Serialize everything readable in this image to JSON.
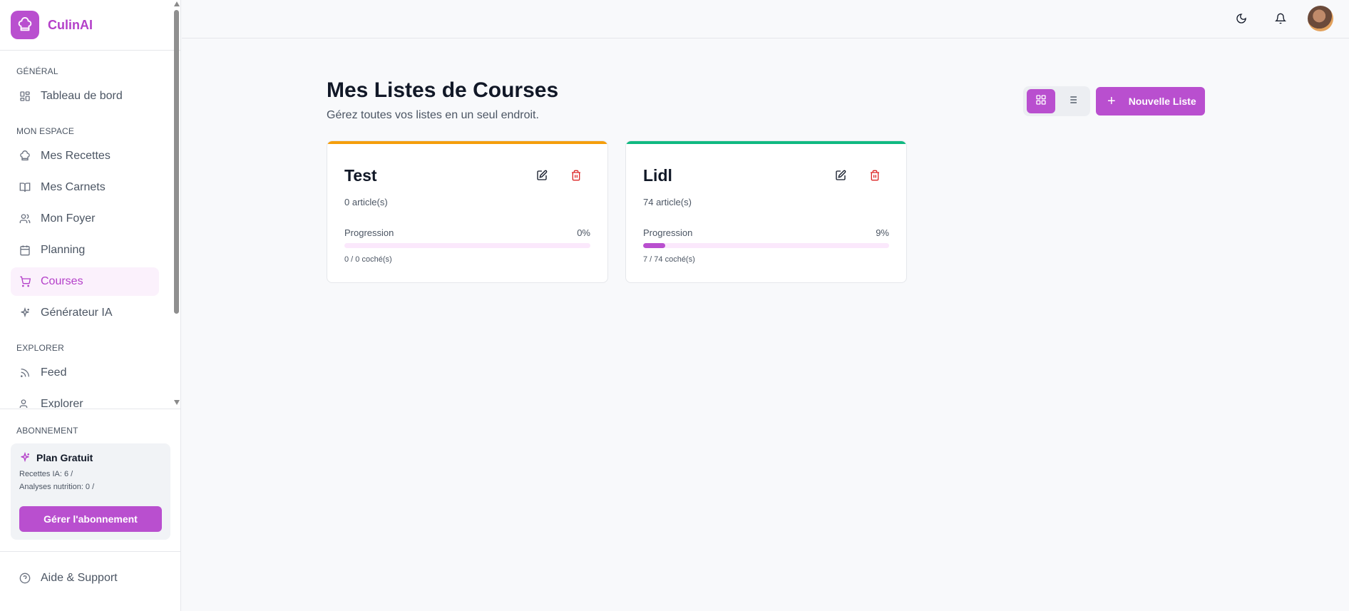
{
  "app": {
    "name": "CulinAI"
  },
  "sidebar": {
    "sections": [
      {
        "title": "GÉNÉRAL"
      },
      {
        "title": "MON ESPACE"
      },
      {
        "title": "EXPLORER"
      }
    ],
    "items": [
      {
        "label": "Tableau de bord",
        "icon": "dashboard-icon"
      },
      {
        "label": "Mes Recettes",
        "icon": "chef-hat-icon"
      },
      {
        "label": "Mes Carnets",
        "icon": "book-icon"
      },
      {
        "label": "Mon Foyer",
        "icon": "users-icon"
      },
      {
        "label": "Planning",
        "icon": "calendar-icon"
      },
      {
        "label": "Courses",
        "icon": "cart-icon",
        "active": true
      },
      {
        "label": "Générateur IA",
        "icon": "sparkles-icon"
      },
      {
        "label": "Feed",
        "icon": "rss-icon"
      },
      {
        "label": "Explorer",
        "icon": "users-icon"
      }
    ],
    "subscription": {
      "title": "ABONNEMENT",
      "plan": "Plan Gratuit",
      "ai_recipes": "Recettes IA: 6 /",
      "nutrition": "Analyses nutrition: 0 /",
      "manage_label": "Gérer l'abonnement"
    },
    "help_label": "Aide & Support"
  },
  "header": {
    "theme_icon": "moon-icon",
    "notif_icon": "bell-icon"
  },
  "main": {
    "title": "Mes Listes de Courses",
    "subtitle": "Gérez toutes vos listes en un seul endroit.",
    "new_list_label": "Nouvelle Liste",
    "progress_label": "Progression",
    "lists": [
      {
        "name": "Test",
        "count": "0 article(s)",
        "percent": "0%",
        "progress": 0,
        "checked": "0 / 0 coché(s)",
        "accent": "#f59e0b"
      },
      {
        "name": "Lidl",
        "count": "74 article(s)",
        "percent": "9%",
        "progress": 0.09,
        "checked": "7 / 74 coché(s)",
        "accent": "#10b981"
      }
    ]
  },
  "colors": {
    "primary": "#b94fcf",
    "danger": "#dc2626"
  }
}
